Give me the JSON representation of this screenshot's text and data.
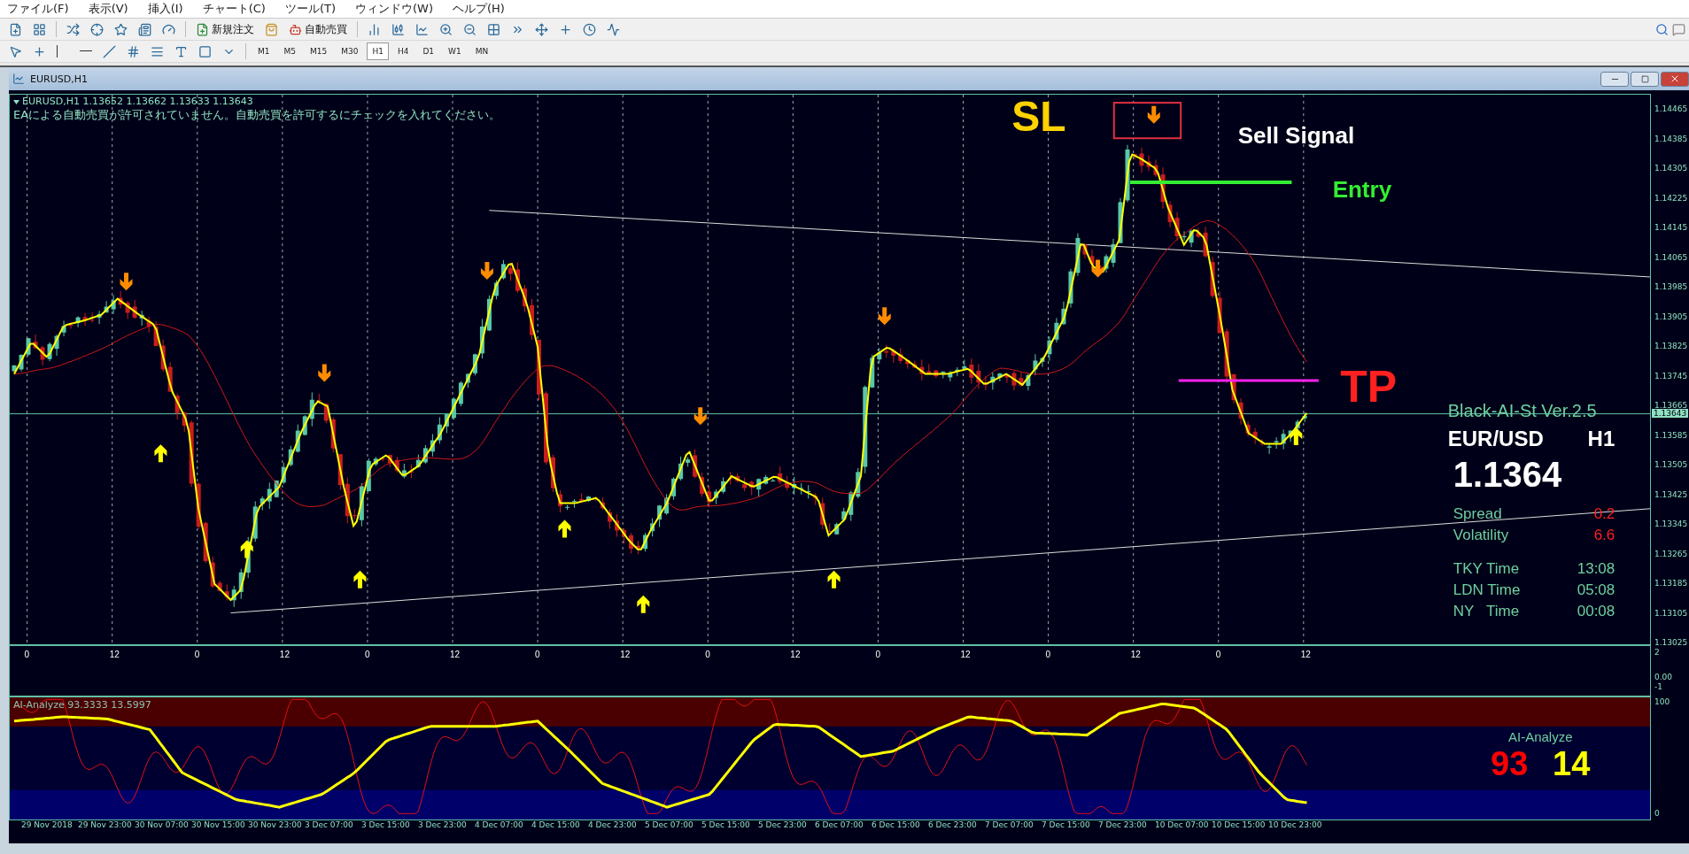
{
  "menu": [
    "ファイル(F)",
    "表示(V)",
    "挿入(I)",
    "チャート(C)",
    "ツール(T)",
    "ウィンドウ(W)",
    "ヘルプ(H)"
  ],
  "toolbar": {
    "order_button": "新規注文",
    "autotrade_button": "自動売買"
  },
  "timeframes": [
    {
      "label": "M1",
      "selected": false
    },
    {
      "label": "M5",
      "selected": false
    },
    {
      "label": "M15",
      "selected": false
    },
    {
      "label": "M30",
      "selected": false
    },
    {
      "label": "H1",
      "selected": true
    },
    {
      "label": "H4",
      "selected": false
    },
    {
      "label": "D1",
      "selected": false
    },
    {
      "label": "W1",
      "selected": false
    },
    {
      "label": "MN",
      "selected": false
    }
  ],
  "chart_window": {
    "title": "EURUSD,H1"
  },
  "chart": {
    "header": "EURUSD,H1  1.13652 1.13662 1.13633 1.13643",
    "warning": "EAによる自動売買が許可されていません。自動売買を許可するにチェックを入れてください。",
    "price_ticks": [
      "1.14465",
      "1.14385",
      "1.14305",
      "1.14225",
      "1.14145",
      "1.14065",
      "1.13985",
      "1.13905",
      "1.13825",
      "1.13745",
      "1.13665",
      "1.13585",
      "1.13505",
      "1.13425",
      "1.13345",
      "1.13265",
      "1.13185",
      "1.13105",
      "1.13025"
    ],
    "current_price": "1.13643",
    "hour_labels": [
      "0",
      "12",
      "0",
      "12",
      "0",
      "12",
      "0",
      "12",
      "0",
      "12",
      "0",
      "12",
      "0",
      "12",
      "0",
      "12"
    ],
    "sl": "SL",
    "signal": "Sell Signal",
    "entry": "Entry",
    "tp": "TP"
  },
  "panel": {
    "title": "Black-AI-St Ver.2.5",
    "pair": "EUR/USD",
    "timeframe": "H1",
    "price": "1.1364",
    "stats": [
      {
        "label": "Spread",
        "value": "0.2"
      },
      {
        "label": "Volatility",
        "value": "6.6"
      }
    ],
    "times": [
      {
        "label": "TKY Time",
        "value": "13:08"
      },
      {
        "label": "LDN Time",
        "value": "05:08"
      },
      {
        "label": "NY   Time",
        "value": "00:08"
      }
    ]
  },
  "subwindow": {
    "ticks": [
      "2",
      "0.00",
      "-1"
    ]
  },
  "indicator": {
    "label": "AI-Analyze 93.3333 13.5997",
    "ticks": [
      "100",
      "0"
    ],
    "title": "AI-Analyze",
    "values": [
      {
        "value": "93",
        "color": "#ff0000"
      },
      {
        "value": "14",
        "color": "#ffff00"
      }
    ]
  },
  "time_axis": [
    "29 Nov 2018",
    "29 Nov 23:00",
    "30 Nov 07:00",
    "30 Nov 15:00",
    "30 Nov 23:00",
    "3 Dec 07:00",
    "3 Dec 15:00",
    "3 Dec 23:00",
    "4 Dec 07:00",
    "4 Dec 15:00",
    "4 Dec 23:00",
    "5 Dec 07:00",
    "5 Dec 15:00",
    "5 Dec 23:00",
    "6 Dec 07:00",
    "6 Dec 15:00",
    "6 Dec 23:00",
    "7 Dec 07:00",
    "7 Dec 15:00",
    "7 Dec 23:00",
    "10 Dec 07:00",
    "10 Dec 15:00",
    "10 Dec 23:00"
  ]
}
